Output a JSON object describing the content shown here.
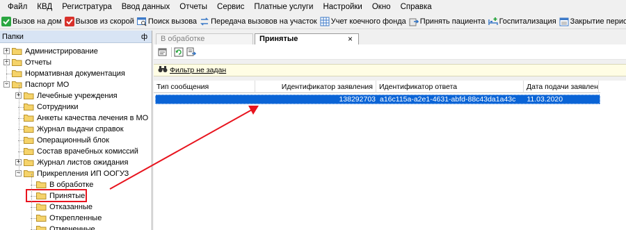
{
  "menu": [
    "Файл",
    "КВД",
    "Регистратура",
    "Ввод данных",
    "Отчеты",
    "Сервис",
    "Платные услуги",
    "Настройки",
    "Окно",
    "Справка"
  ],
  "toolbar": [
    {
      "label": "Вызов на дом",
      "icon": "house-check-icon",
      "color": "#2aa640"
    },
    {
      "label": "Вызов из скорой",
      "icon": "ambulance-icon",
      "color": "#d8312a"
    },
    {
      "label": "Поиск вызова",
      "icon": "search-window-icon",
      "color": "#3c7ac8"
    },
    {
      "label": "Передача вызовов на участок",
      "icon": "transfer-icon",
      "color": "#3c7ac8"
    },
    {
      "label": "Учет коечного фонда",
      "icon": "grid-icon",
      "color": "#3c7ac8"
    },
    {
      "label": "Принять пациента",
      "icon": "accept-patient-icon",
      "color": "#6a6a6a"
    },
    {
      "label": "Госпитализация",
      "icon": "hospital-bed-icon",
      "color": "#2aa640"
    },
    {
      "label": "Закрытие периода",
      "icon": "calendar-close-icon",
      "color": "#3c7ac8"
    }
  ],
  "left_panel": {
    "title": "Папки",
    "pin": "ф",
    "tree": [
      {
        "label": "Администрирование",
        "expander": "+"
      },
      {
        "label": "Отчеты",
        "expander": "+"
      },
      {
        "label": "Нормативная документация",
        "expander": ""
      },
      {
        "label": "Паспорт МО",
        "expander": "-"
      },
      {
        "label": "Лечебные учреждения",
        "expander": "+"
      },
      {
        "label": "Сотрудники",
        "expander": ""
      },
      {
        "label": "Анкеты качества лечения в МО",
        "expander": ""
      },
      {
        "label": "Журнал выдачи справок",
        "expander": ""
      },
      {
        "label": "Операционный блок",
        "expander": ""
      },
      {
        "label": "Состав врачебных комиссий",
        "expander": ""
      },
      {
        "label": "Журнал листов ожидания",
        "expander": "+"
      },
      {
        "label": "Прикрепления ИП ООГУЗ",
        "expander": "-"
      },
      {
        "label": "В обработке",
        "expander": ""
      },
      {
        "label": "Принятые",
        "expander": "",
        "selected": true
      },
      {
        "label": "Отказанные",
        "expander": ""
      },
      {
        "label": "Открепленные",
        "expander": ""
      },
      {
        "label": "Отмененные",
        "expander": ""
      }
    ]
  },
  "tabs": [
    {
      "label": "В обработке",
      "active": false
    },
    {
      "label": "Принятые",
      "active": true,
      "close": "×"
    }
  ],
  "filter": {
    "label": "Фильтр не задан"
  },
  "grid": {
    "columns": [
      "Тип сообщения",
      "Идентификатор заявления",
      "Идентификатор ответа",
      "Дата подачи заявления"
    ],
    "rows": [
      {
        "type": "",
        "id": "138292703",
        "answer_id": "a16c115a-a2e1-4631-abfd-88c43da1a43c",
        "date": "11.03.2020"
      }
    ]
  },
  "colors": {
    "selection": "#0a64d6",
    "highlight": "#e8141e",
    "filter_bg": "#fffde4",
    "folder": "#f5d36a"
  }
}
